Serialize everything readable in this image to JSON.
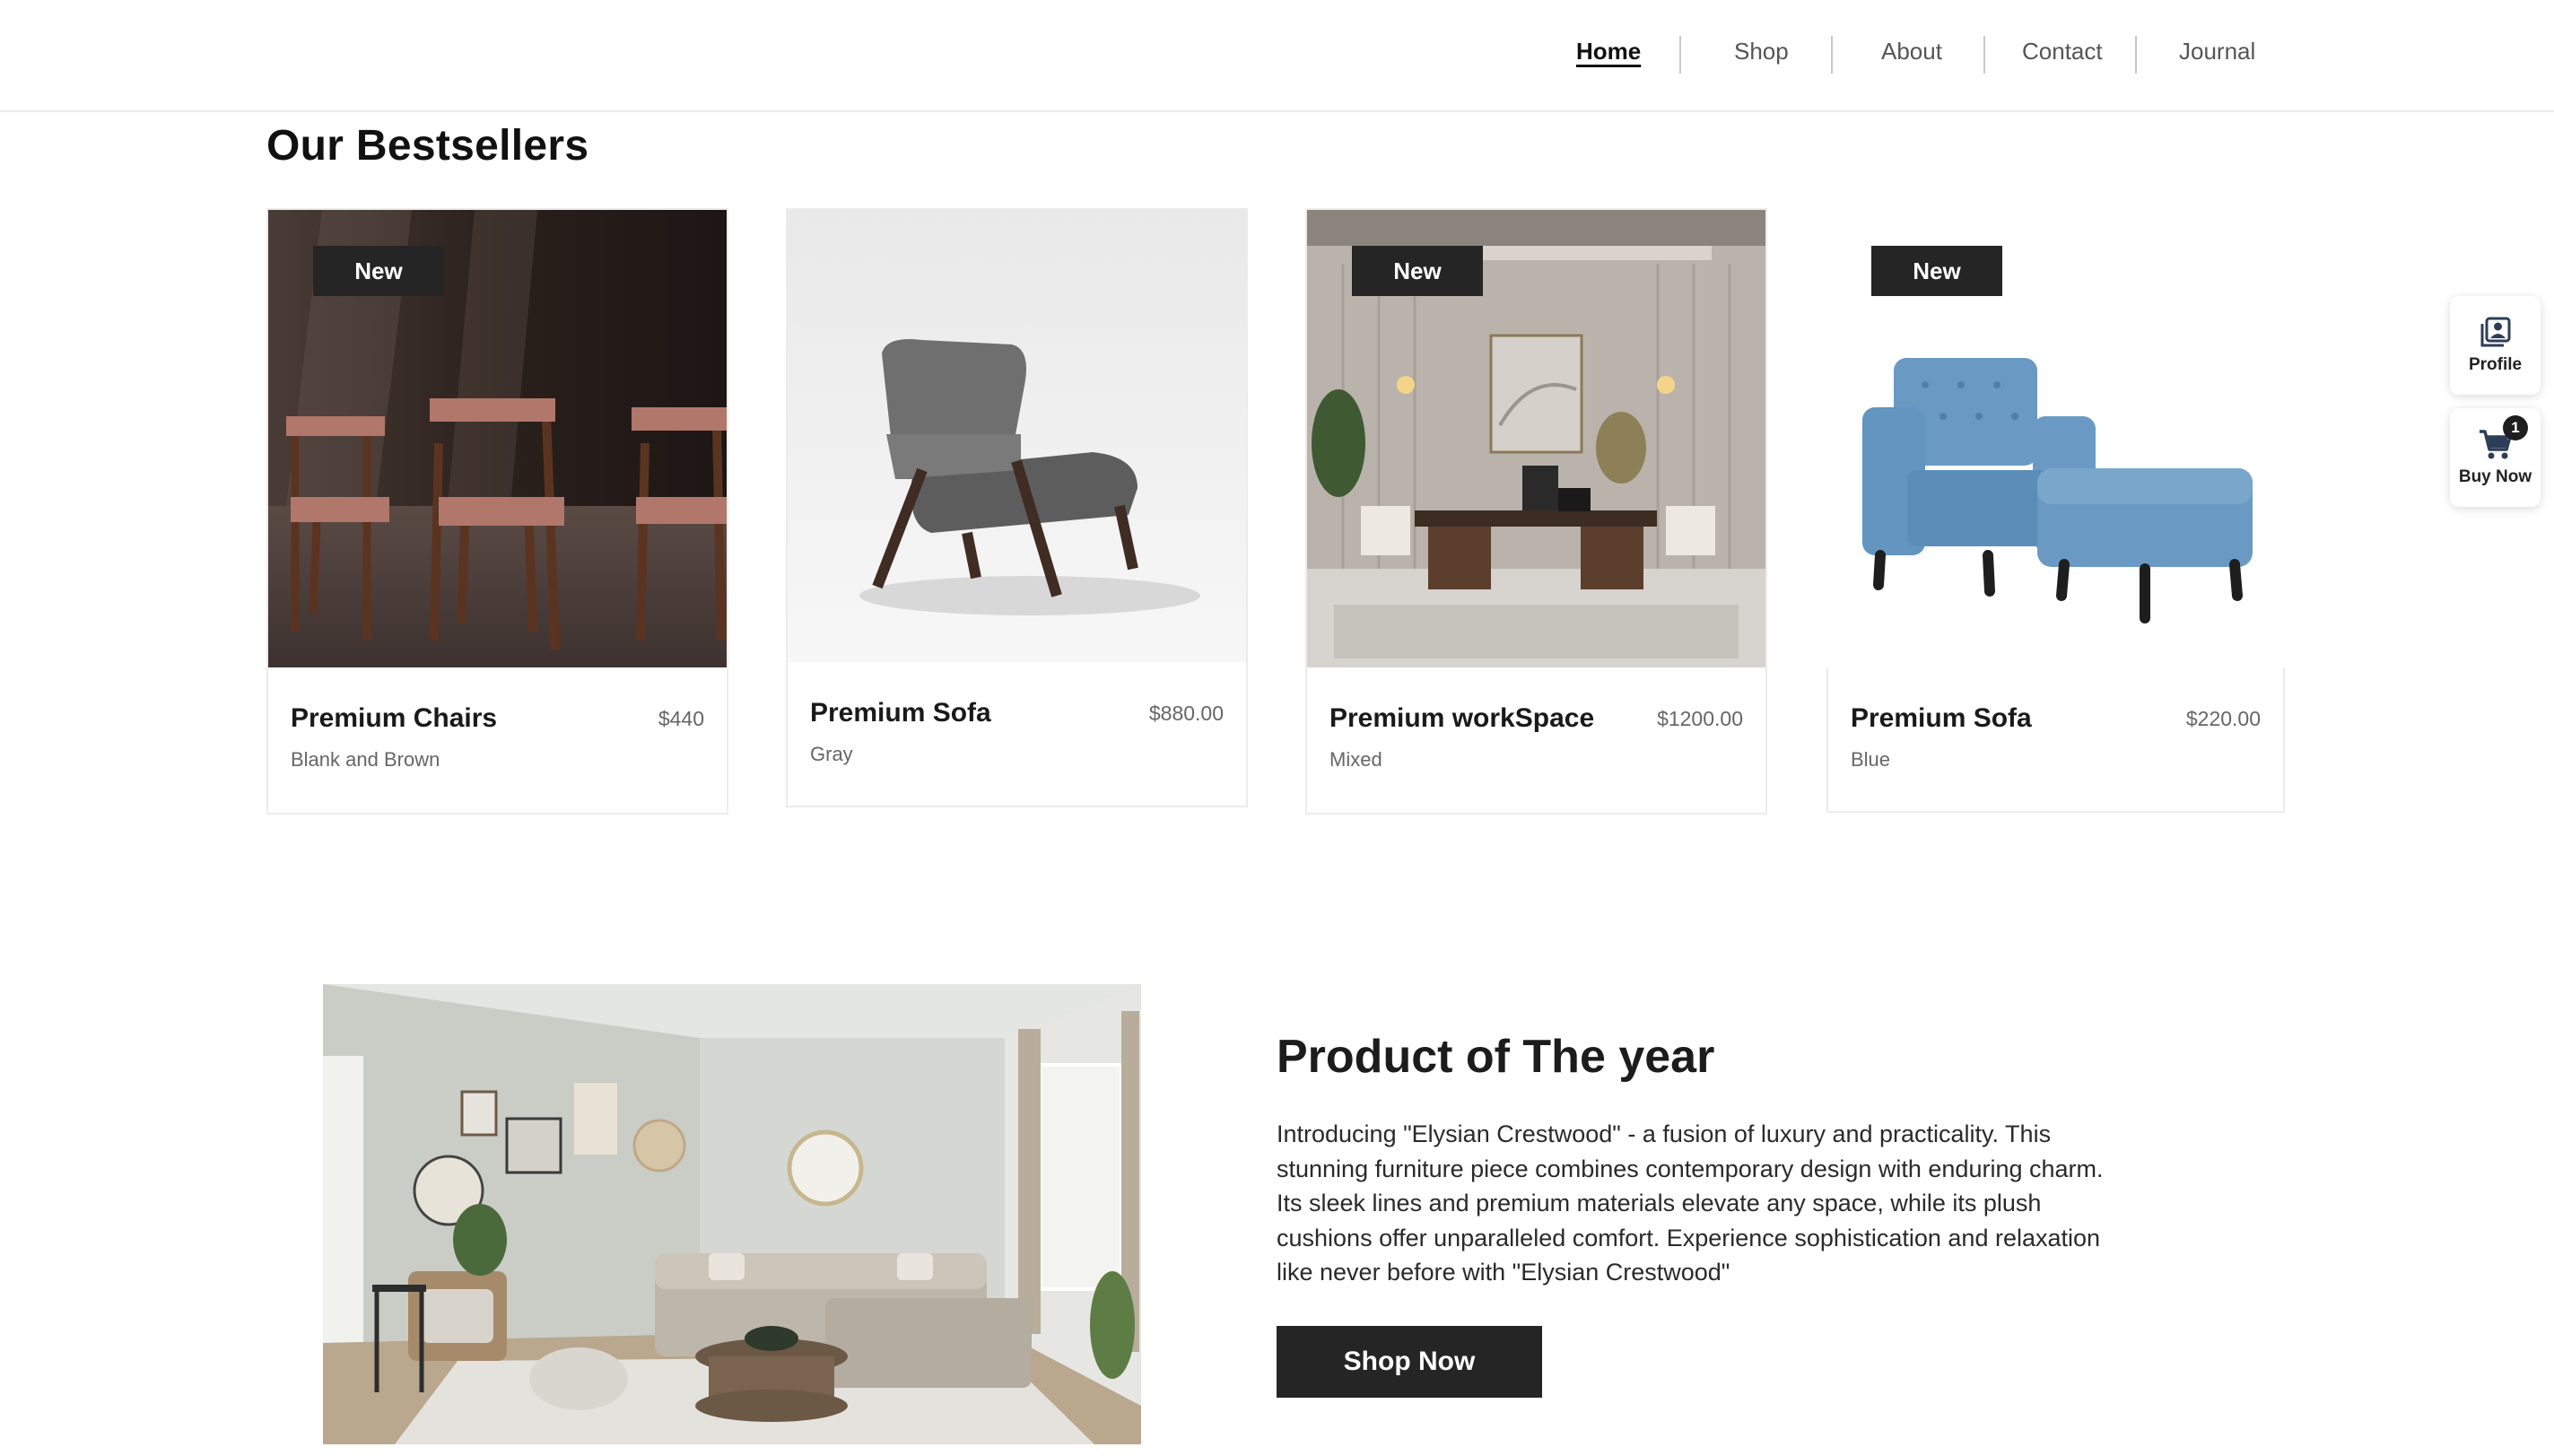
{
  "nav": {
    "items": [
      {
        "label": "Home",
        "active": true
      },
      {
        "label": "Shop",
        "active": false
      },
      {
        "label": "About",
        "active": false
      },
      {
        "label": "Contact",
        "active": false
      },
      {
        "label": "Journal",
        "active": false
      }
    ]
  },
  "bestsellers": {
    "title": "Our Bestsellers",
    "products": [
      {
        "name": "Premium Chairs",
        "price": "$440",
        "variant": "Blank and Brown",
        "badge": "New"
      },
      {
        "name": "Premium Sofa",
        "price": "$880.00",
        "variant": "Gray",
        "badge": ""
      },
      {
        "name": "Premium workSpace",
        "price": "$1200.00",
        "variant": "Mixed",
        "badge": "New"
      },
      {
        "name": "Premium Sofa",
        "price": "$220.00",
        "variant": "Blue",
        "badge": "New"
      }
    ]
  },
  "side_panel": {
    "profile_label": "Profile",
    "cart_label": "Buy Now",
    "cart_count": "1"
  },
  "product_of_year": {
    "title": "Product of The year",
    "description": "Introducing \"Elysian Crestwood\" - a fusion of luxury and practicality. This stunning furniture piece combines contemporary design with enduring charm. Its sleek lines and premium materials elevate any space, while its plush cushions offer unparalleled comfort. Experience sophistication and relaxation like never before with \"Elysian Crestwood\"",
    "button_label": "Shop Now"
  },
  "colors": {
    "accent_dark": "#252525",
    "text_muted": "#666666",
    "border": "#ececec"
  }
}
